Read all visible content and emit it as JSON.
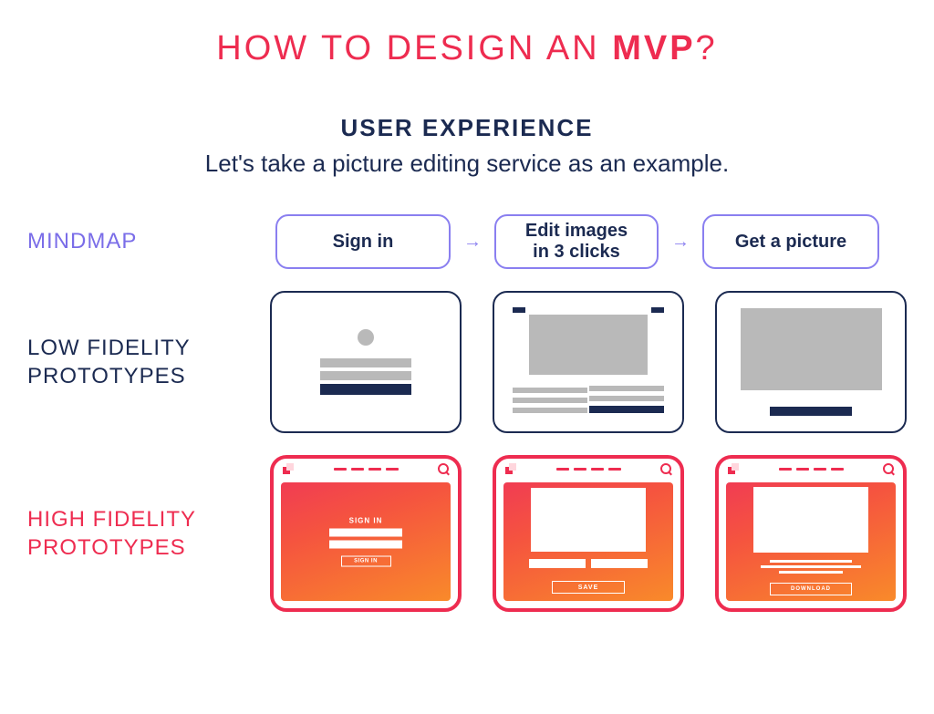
{
  "title": {
    "pre": "HOW TO DESIGN AN ",
    "bold": "MVP",
    "post": "?"
  },
  "subtitle": {
    "line1": "USER EXPERIENCE",
    "line2": "Let's take a picture editing service as an example."
  },
  "rows": {
    "mindmap": {
      "label": "MINDMAP",
      "steps": [
        "Sign in",
        "Edit images\nin 3 clicks",
        "Get a picture"
      ]
    },
    "lowfi": {
      "label": "LOW FIDELITY\nPROTOTYPES"
    },
    "hifi": {
      "label": "HIGH FIDELITY\nPROTOTYPES",
      "card1": {
        "heading": "SIGN IN",
        "button": "SIGN IN"
      },
      "card2": {
        "button": "SAVE"
      },
      "card3": {
        "button": "DOWNLOAD"
      }
    }
  }
}
